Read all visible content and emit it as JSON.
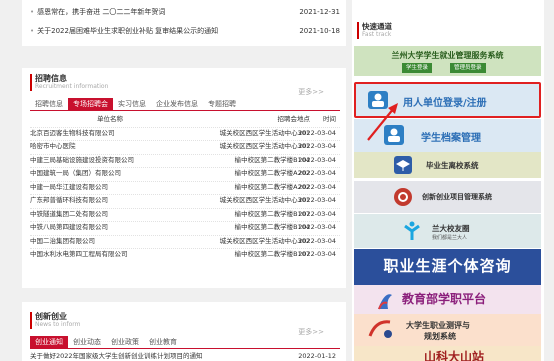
{
  "news_top": [
    {
      "title": "感恩常在，携手奋进 二〇二二年新年贺词",
      "date": "2021-12-31"
    },
    {
      "title": "关于2022届困难毕业生求职创业补贴 复审结果公示的通知",
      "date": "2021-10-18"
    }
  ],
  "recruit": {
    "title": "招聘信息",
    "subtitle": "Recruitment information",
    "more": "更多>>",
    "tabs": [
      "招聘信息",
      "专场招聘会",
      "实习信息",
      "企业发布信息",
      "专题招聘"
    ],
    "active_tab": 1,
    "columns": {
      "name": "单位名称",
      "location": "招聘会地点",
      "time": "时间"
    },
    "rows": [
      {
        "name": "北京百迈客生物科技有限公司",
        "location": "城关校区西区学生活动中心301",
        "time": "2022-03-04"
      },
      {
        "name": "哈密市中心医院",
        "location": "城关校区西区学生活动中心301",
        "time": "2022-03-04"
      },
      {
        "name": "中建三局基础设施建设投资有限公司",
        "location": "榆中校区第二教学楼B104",
        "time": "2022-03-04"
      },
      {
        "name": "中国建筑一局（集团）有限公司",
        "location": "榆中校区第二教学楼A202",
        "time": "2022-03-04"
      },
      {
        "name": "中建一局华江建设有限公司",
        "location": "榆中校区第二教学楼A202",
        "time": "2022-03-04"
      },
      {
        "name": "广东邦普循环科技有限公司",
        "location": "城关校区西区学生活动中心301",
        "time": "2022-03-04"
      },
      {
        "name": "中铁隧道集团二处有限公司",
        "location": "榆中校区第二教学楼B107",
        "time": "2022-03-04"
      },
      {
        "name": "中铁八局第四建设有限公司",
        "location": "榆中校区第二教学楼B104",
        "time": "2022-03-04"
      },
      {
        "name": "中国二治集团有限公司",
        "location": "城关校区西区学生活动中心302",
        "time": "2022-03-04"
      },
      {
        "name": "中国水利水电第四工程局有限公司",
        "location": "榆中校区第二教学楼B107",
        "time": "2022-03-04"
      }
    ]
  },
  "innovation": {
    "title": "创新创业",
    "subtitle": "News to inform",
    "more": "更多>>",
    "tabs": [
      "创业通知",
      "创业动态",
      "创业政策",
      "创业教育"
    ],
    "active_tab": 0,
    "first_row": {
      "title": "关于做好2022年国家级大学生创新创业训练计划项目的通知",
      "date": "2022-01-12"
    }
  },
  "quick": {
    "title": "快速通道",
    "subtitle": "Fast track",
    "sys_title": "兰州大学学生就业管理服务系统",
    "student_login": "学生登录",
    "admin_login": "管理员登录",
    "employer_login": "用人单位登录/注册",
    "student_archive": "学生档案管理",
    "graduate_leave": "毕业生离校系统",
    "innovation_project": "创新创业项目管理系统",
    "alumni_title": "兰大校友圈",
    "alumni_sub": "我们都是兰大人",
    "career_consult": "职业生涯个体咨询",
    "edu_platform": "教育部学职平台",
    "eval_line1": "大学生职业测评与",
    "eval_line2": "规划系统",
    "last_label": "山科大山站"
  },
  "colors": {
    "accent": "#c8102e",
    "highlight_border": "#e02020",
    "career_bg": "#2b4f9b"
  }
}
